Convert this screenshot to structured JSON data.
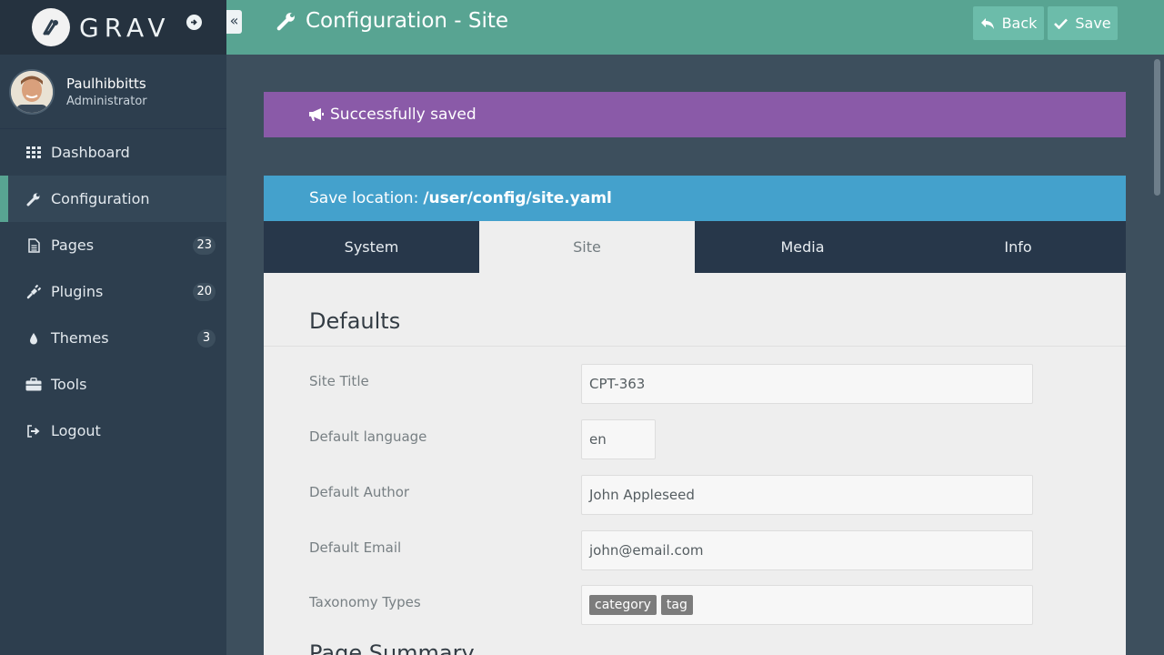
{
  "brand": {
    "name": "GRAV"
  },
  "user": {
    "name": "Paulhibbitts",
    "role": "Administrator"
  },
  "nav": {
    "collapse_glyph": "«",
    "items": [
      {
        "label": "Dashboard",
        "icon": "grid-icon"
      },
      {
        "label": "Configuration",
        "icon": "wrench-icon",
        "active": true
      },
      {
        "label": "Pages",
        "icon": "file-icon",
        "badge": "23"
      },
      {
        "label": "Plugins",
        "icon": "plug-icon",
        "badge": "20"
      },
      {
        "label": "Themes",
        "icon": "droplet-icon",
        "badge": "3"
      },
      {
        "label": "Tools",
        "icon": "briefcase-icon"
      },
      {
        "label": "Logout",
        "icon": "sign-out-icon"
      }
    ]
  },
  "header": {
    "title": "Configuration - Site",
    "back_label": "Back",
    "save_label": "Save"
  },
  "alerts": {
    "success": "Successfully saved",
    "location_label": "Save location:",
    "location_path": "/user/config/site.yaml"
  },
  "tabs": [
    {
      "label": "System"
    },
    {
      "label": "Site",
      "active": true
    },
    {
      "label": "Media"
    },
    {
      "label": "Info"
    }
  ],
  "form": {
    "section_title": "Defaults",
    "fields": [
      {
        "label": "Site Title",
        "value": "CPT-363"
      },
      {
        "label": "Default language",
        "value": "en"
      },
      {
        "label": "Default Author",
        "value": "John Appleseed"
      },
      {
        "label": "Default Email",
        "value": "john@email.com"
      },
      {
        "label": "Taxonomy Types",
        "tags": [
          "category",
          "tag"
        ]
      }
    ],
    "next_section_title": "Page Summary"
  },
  "colors": {
    "sidebar": "#2d3e4e",
    "topbar": "#58a492",
    "success": "#8a5aa8",
    "info": "#44a1cc",
    "tabs": "#27374a"
  }
}
